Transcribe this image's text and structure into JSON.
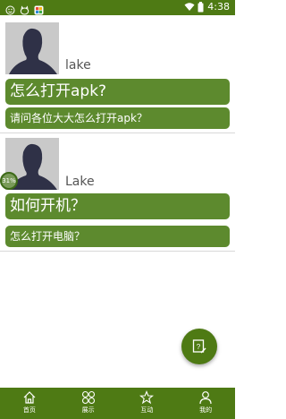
{
  "status_bar": {
    "time": "4:38",
    "icons": [
      "smiley-icon",
      "cat-icon",
      "app-icon",
      "wifi-icon",
      "battery-icon"
    ]
  },
  "posts": [
    {
      "author": "lake",
      "title": "怎么打开apk?",
      "body": "请问各位大大怎么打开apk？"
    },
    {
      "author": "Lake",
      "title": "如何开机？",
      "body": "怎么打开电脑？"
    }
  ],
  "progress_badge": {
    "text": "31%",
    "value": 0.31
  },
  "fab": {
    "icon": "compose-icon"
  },
  "tabbar": {
    "tabs": [
      {
        "label": "首页",
        "icon": "home-icon"
      },
      {
        "label": "展示",
        "icon": "grid-circles-icon"
      },
      {
        "label": "互动",
        "icon": "star-icon"
      },
      {
        "label": "我的",
        "icon": "person-icon"
      }
    ]
  },
  "colors": {
    "primary": "#4e7a14",
    "card": "#5d8a2e"
  }
}
